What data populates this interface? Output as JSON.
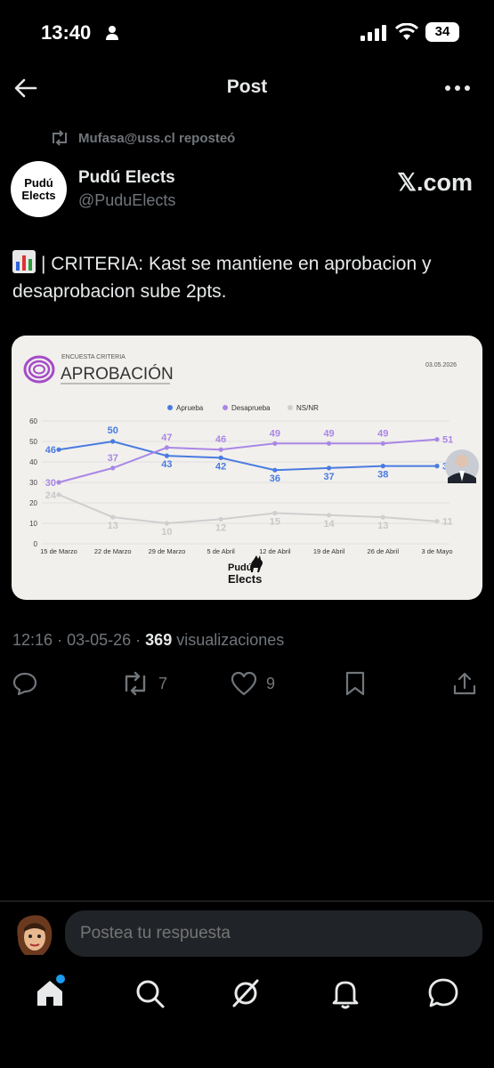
{
  "status_bar": {
    "time": "13:40",
    "battery": "34"
  },
  "nav": {
    "title": "Post"
  },
  "repost": {
    "text": "Mufasa@uss.cl reposteó"
  },
  "author": {
    "name": "Pudú Elects",
    "handle": "@PuduElects",
    "avatar_line1": "Pudú",
    "avatar_line2": "Elects",
    "source": "𝕏.com"
  },
  "tweet": {
    "text": "| CRITERIA: Kast se mantiene en aprobacion y desaprobacion sube 2pts."
  },
  "card": {
    "kicker": "ENCUESTA CRITERIA",
    "title": "APROBACIÓN",
    "date": "03.05.2026",
    "logo_line1": "Pudú",
    "logo_line2": "Elects"
  },
  "chart_data": {
    "type": "line",
    "categories": [
      "15 de Marzo",
      "22 de Marzo",
      "29 de Marzo",
      "5 de Abril",
      "12 de Abril",
      "19 de Abril",
      "26 de Abril",
      "3 de Mayo"
    ],
    "ylim": [
      0,
      60
    ],
    "yticks": [
      0,
      10,
      20,
      30,
      40,
      50,
      60
    ],
    "grid": true,
    "legend_position": "top-center",
    "series": [
      {
        "name": "Aprueba",
        "color": "#4a7be0",
        "values": [
          46,
          50,
          43,
          42,
          36,
          37,
          38,
          38
        ],
        "labels": [
          "46",
          "50",
          "43",
          "42",
          "36",
          "37",
          "38",
          "38"
        ]
      },
      {
        "name": "Desaprueba",
        "color": "#a987e6",
        "values": [
          30,
          37,
          47,
          46,
          49,
          49,
          49,
          51
        ],
        "labels": [
          "30",
          "37",
          "47",
          "46",
          "49",
          "49",
          "49",
          "51"
        ]
      },
      {
        "name": "NS/NR",
        "color": "#cfcfcf",
        "values": [
          24,
          13,
          10,
          12,
          15,
          14,
          13,
          11
        ],
        "labels": [
          "24",
          "13",
          "10",
          "12",
          "15",
          "14",
          "13",
          "11"
        ]
      }
    ]
  },
  "meta": {
    "time": "12:16",
    "date": "03-05-26",
    "views": "369",
    "views_label": "visualizaciones",
    "sep": "·"
  },
  "actions": {
    "retweets": "7",
    "likes": "9"
  },
  "reply": {
    "placeholder": "Postea tu respuesta"
  },
  "colors": {
    "background": "#000000",
    "accent": "#1d9bf0",
    "muted": "#71767b"
  },
  "icons": [
    "back-arrow-icon",
    "more-icon",
    "repost-icon",
    "reply-icon",
    "retweet-icon",
    "like-icon",
    "bookmark-icon",
    "share-icon",
    "home-icon",
    "search-icon",
    "grok-icon",
    "bell-icon",
    "messages-icon"
  ]
}
